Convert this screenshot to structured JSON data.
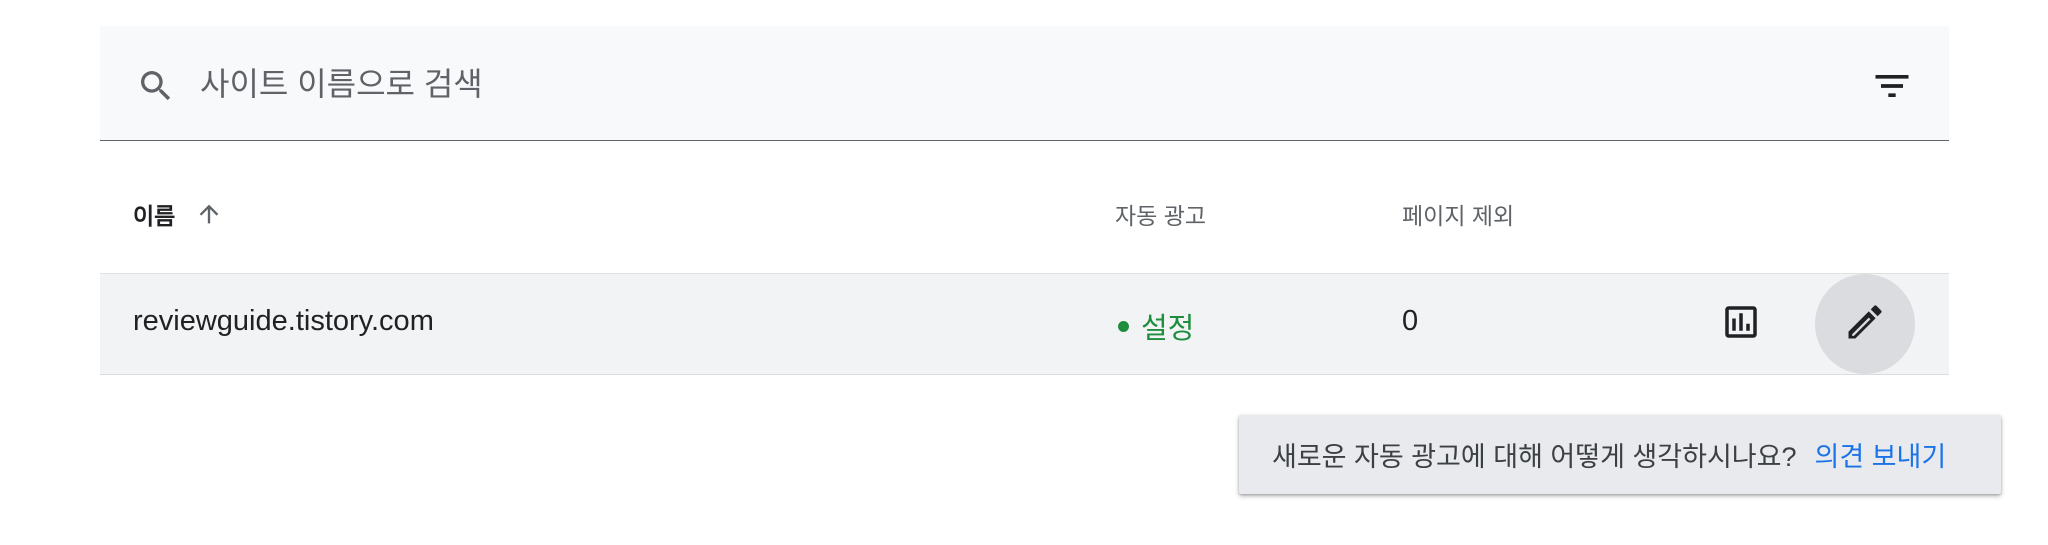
{
  "search": {
    "placeholder": "사이트 이름으로 검색",
    "value": ""
  },
  "icons": {
    "search": "search-icon",
    "filter": "filter-icon",
    "sort": "arrow-up-icon",
    "report": "bar-chart-icon",
    "edit": "pencil-icon"
  },
  "table": {
    "columns": {
      "name": "이름",
      "auto_ads": "자동 광고",
      "page_exclusions": "페이지 제외"
    },
    "rows": [
      {
        "name": "reviewguide.tistory.com",
        "auto_ads": "설정",
        "page_exclusions": "0"
      }
    ]
  },
  "feedback": {
    "message": "새로운 자동 광고에 대해 어떻게 생각하시나요?",
    "link": "의견 보내기"
  },
  "colors": {
    "status_on": "#1e8e3e",
    "link": "#1a73e8",
    "search_bg": "#f8f9fa",
    "row_bg": "#f1f3f4"
  }
}
